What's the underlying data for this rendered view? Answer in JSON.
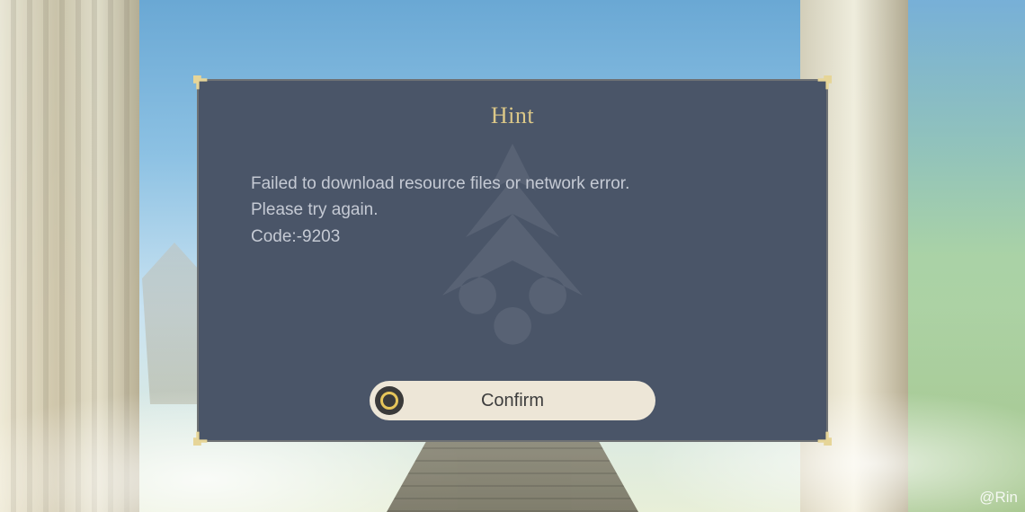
{
  "dialog": {
    "title": "Hint",
    "message_line1": "Failed to download resource files or network error.",
    "message_line2": "Please try again.",
    "message_line3": "Code:-9203",
    "confirm_label": "Confirm"
  },
  "watermark": "@Rin"
}
